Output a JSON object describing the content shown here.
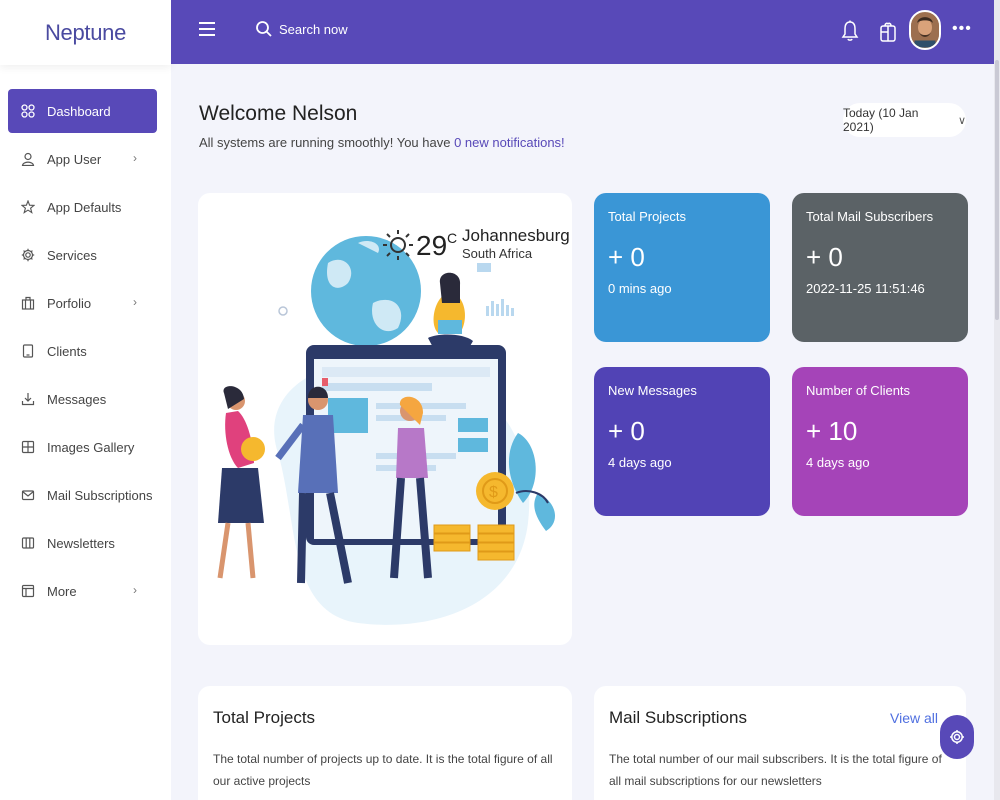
{
  "app": {
    "logo": "Neptune"
  },
  "sidebar": {
    "items": [
      {
        "label": "Dashboard",
        "icon": "grid-icon",
        "active": true
      },
      {
        "label": "App User",
        "icon": "user-icon",
        "chevron": true
      },
      {
        "label": "App Defaults",
        "icon": "star-icon"
      },
      {
        "label": "Services",
        "icon": "gear-icon"
      },
      {
        "label": "Porfolio",
        "icon": "briefcase-icon",
        "chevron": true
      },
      {
        "label": "Clients",
        "icon": "tablet-icon"
      },
      {
        "label": "Messages",
        "icon": "download-icon"
      },
      {
        "label": "Images Gallery",
        "icon": "grid-square-icon"
      },
      {
        "label": "Mail Subscriptions",
        "icon": "mail-icon"
      },
      {
        "label": "Newsletters",
        "icon": "columns-icon"
      },
      {
        "label": "More",
        "icon": "layout-icon",
        "chevron": true
      }
    ]
  },
  "topbar": {
    "search_placeholder": "Search now"
  },
  "welcome": {
    "title": "Welcome Nelson",
    "subtitle_prefix": "All systems are running smoothly! You have ",
    "notifications_link": "0 new notifications!"
  },
  "date_selector": {
    "label": "Today (10 Jan 2021)"
  },
  "weather": {
    "temperature": "29",
    "unit": "C",
    "city": "Johannesburg",
    "country": "South Africa"
  },
  "stats": [
    {
      "label": "Total Projects",
      "value": "+ 0",
      "time": "0 mins ago",
      "color": "#3a96d6"
    },
    {
      "label": "Total Mail Subscribers",
      "value": "+ 0",
      "time": "2022-11-25 11:51:46",
      "color": "#5b6266"
    },
    {
      "label": "New Messages",
      "value": "+ 0",
      "time": "4 days ago",
      "color": "#5143b5"
    },
    {
      "label": "Number of Clients",
      "value": "+ 10",
      "time": "4 days ago",
      "color": "#a544b8"
    }
  ],
  "info_cards": [
    {
      "title": "Total Projects",
      "text": "The total number of projects up to date. It is the total figure of all our active projects"
    },
    {
      "title": "Mail Subscriptions",
      "text": "The total number of our mail subscribers. It is the total figure of all mail subscriptions for our newsletters",
      "link": "View all"
    }
  ],
  "colors": {
    "primary": "#5849b8",
    "background": "#f3f4fb"
  }
}
